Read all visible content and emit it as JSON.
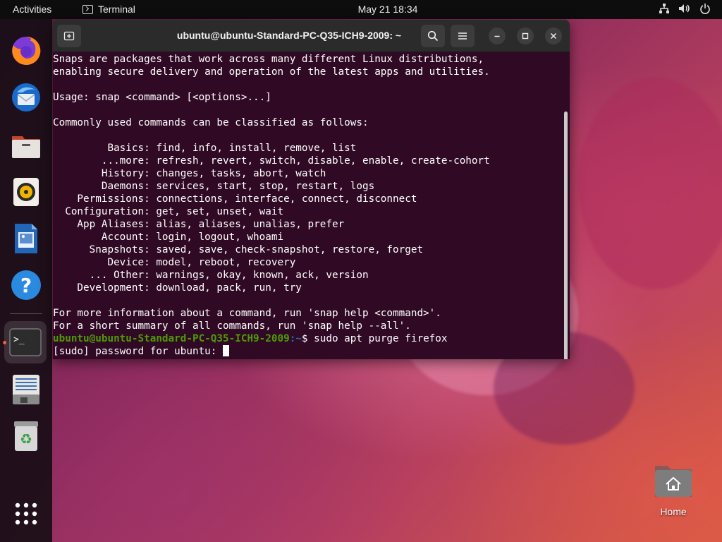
{
  "topbar": {
    "activities_label": "Activities",
    "app_name": "Terminal",
    "clock": "May 21  18:34"
  },
  "dock": {
    "items": [
      "firefox",
      "thunderbird",
      "files",
      "rhythmbox",
      "libreoffice-writer",
      "help",
      "terminal",
      "text-editor",
      "trash",
      "show-applications"
    ],
    "active": "terminal"
  },
  "terminal": {
    "title": "ubuntu@ubuntu-Standard-PC-Q35-ICH9-2009: ~",
    "lines": [
      "Snaps are packages that work across many different Linux distributions,",
      "enabling secure delivery and operation of the latest apps and utilities.",
      "",
      "Usage: snap <command> [<options>...]",
      "",
      "Commonly used commands can be classified as follows:",
      "",
      "         Basics: find, info, install, remove, list",
      "        ...more: refresh, revert, switch, disable, enable, create-cohort",
      "        History: changes, tasks, abort, watch",
      "        Daemons: services, start, stop, restart, logs",
      "    Permissions: connections, interface, connect, disconnect",
      "  Configuration: get, set, unset, wait",
      "    App Aliases: alias, aliases, unalias, prefer",
      "        Account: login, logout, whoami",
      "      Snapshots: saved, save, check-snapshot, restore, forget",
      "         Device: model, reboot, recovery",
      "      ... Other: warnings, okay, known, ack, version",
      "    Development: download, pack, run, try",
      "",
      "For more information about a command, run 'snap help <command>'.",
      "For a short summary of all commands, run 'snap help --all'."
    ],
    "prompt_user": "ubuntu@ubuntu-Standard-PC-Q35-ICH9-2009",
    "prompt_path": ":~",
    "prompt_symbol": "$ ",
    "command": "sudo apt purge firefox",
    "sudo_prompt": "[sudo] password for ubuntu: "
  },
  "desktop": {
    "home_label": "Home"
  },
  "colors": {
    "terminal_bg": "#300a24",
    "prompt_user": "#4e9a06",
    "prompt_path": "#3465a4",
    "accent": "#e9541e"
  }
}
